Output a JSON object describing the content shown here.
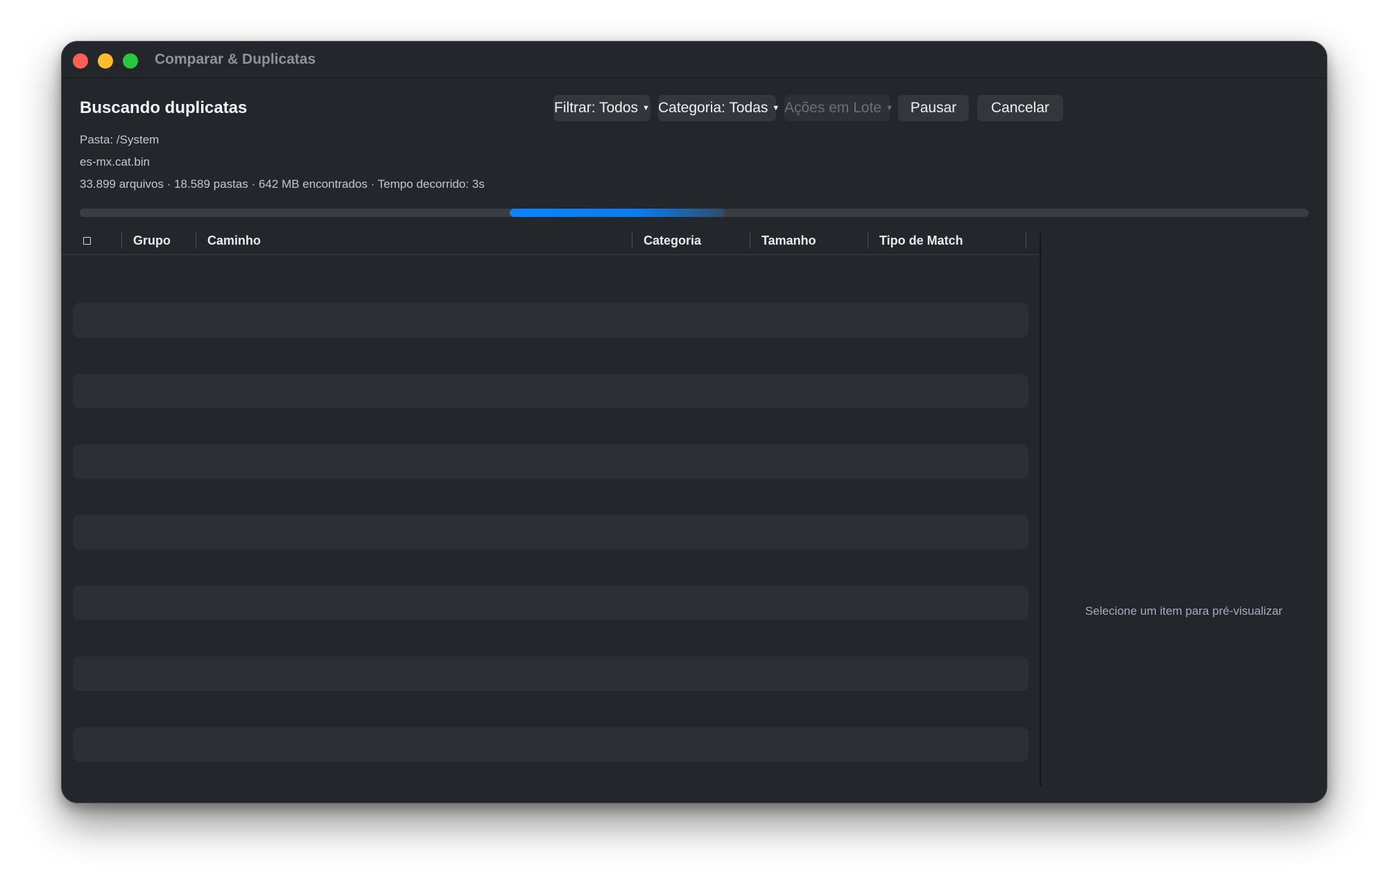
{
  "window": {
    "title": "Comparar & Duplicatas"
  },
  "header": {
    "title": "Buscando duplicatas",
    "filter_label": "Filtrar: Todos",
    "category_label": "Categoria: Todas",
    "batch_actions_label": "Ações em Lote",
    "pause_label": "Pausar",
    "cancel_label": "Cancelar"
  },
  "status": {
    "folder": "Pasta: /System",
    "current_file": "es-mx.cat.bin",
    "summary": "33.899 arquivos · 18.589 pastas · 642 MB encontrados · Tempo decorrido: 3s",
    "progress_state": "indeterminate"
  },
  "table": {
    "columns": [
      "Grupo",
      "Caminho",
      "Categoria",
      "Tamanho",
      "Tipo de Match"
    ],
    "loading_placeholder_rows": 7
  },
  "preview": {
    "empty_text": "Selecione um item para pré-visualizar"
  },
  "colors": {
    "window_bg": "#23272b",
    "accent": "#0a84ff",
    "placeholder_row": "#2c3035",
    "close": "#fe5f57",
    "minimize": "#febc2e",
    "zoom": "#28c840"
  },
  "icons": {
    "header_checkbox": "checkbox-icon",
    "dropdown_caret": "caret-down-icon"
  }
}
